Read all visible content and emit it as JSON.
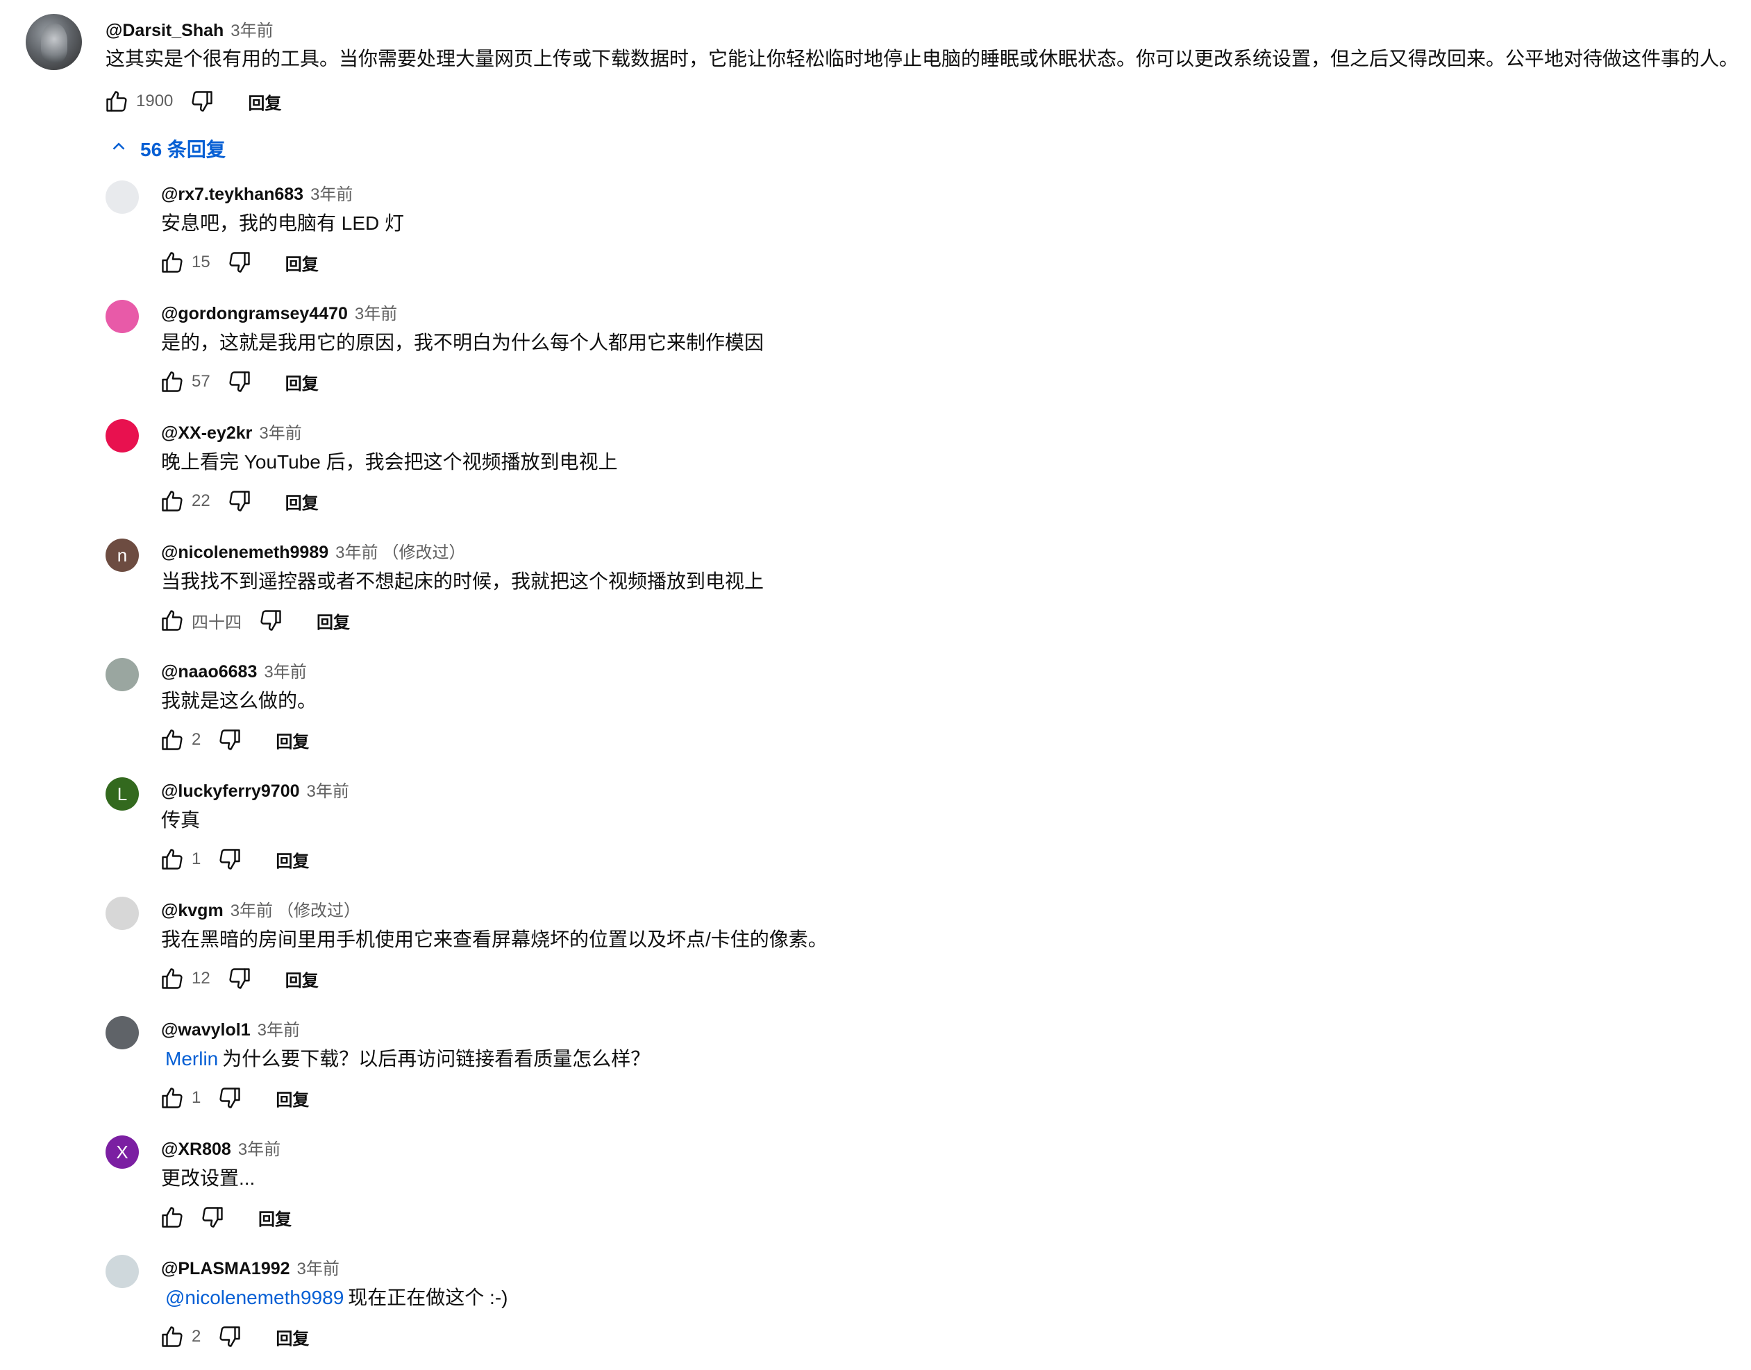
{
  "main_comment": {
    "author": "@Darsit_Shah",
    "time": "3年前",
    "text": "这其实是个很有用的工具。当你需要处理大量网页上传或下载数据时，它能让你轻松临时地停止电脑的睡眠或休眠状态。你可以更改系统设置，但之后又得改回来。公平地对待做这件事的人。",
    "likes": "1900",
    "reply_label": "回复"
  },
  "replies_toggle": {
    "label": "56 条回复",
    "icon": "chevron-up-icon"
  },
  "replies": [
    {
      "author": "@rx7.teykhan683",
      "time": "3年前",
      "edited": "",
      "mention": "",
      "text": "安息吧，我的电脑有 LED 灯",
      "likes": "15",
      "reply_label": "回复",
      "avatar_letter": "",
      "avatar_color": "#e8eaed"
    },
    {
      "author": "@gordongramsey4470",
      "time": "3年前",
      "edited": "",
      "mention": "",
      "text": "是的，这就是我用它的原因，我不明白为什么每个人都用它来制作模因",
      "likes": "57",
      "reply_label": "回复",
      "avatar_letter": "",
      "avatar_color": "#e85aa8"
    },
    {
      "author": "@XX-ey2kr",
      "time": "3年前",
      "edited": "",
      "mention": "",
      "text": "晚上看完 YouTube 后，我会把这个视频播放到电视上",
      "likes": "22",
      "reply_label": "回复",
      "avatar_letter": "",
      "avatar_color": "#e8114f"
    },
    {
      "author": "@nicolenemeth9989",
      "time": "3年前",
      "edited": "（修改过）",
      "mention": "",
      "text": "当我找不到遥控器或者不想起床的时候，我就把这个视频播放到电视上",
      "likes": "四十四",
      "reply_label": "回复",
      "avatar_letter": "n",
      "avatar_color": "#6d4c41"
    },
    {
      "author": "@naao6683",
      "time": "3年前",
      "edited": "",
      "mention": "",
      "text": "我就是这么做的。",
      "likes": "2",
      "reply_label": "回复",
      "avatar_letter": "",
      "avatar_color": "#9aa6a0"
    },
    {
      "author": "@luckyferry9700",
      "time": "3年前",
      "edited": "",
      "mention": "",
      "text": "传真",
      "likes": "1",
      "reply_label": "回复",
      "avatar_letter": "L",
      "avatar_color": "#33691e"
    },
    {
      "author": "@kvgm",
      "time": "3年前",
      "edited": "（修改过）",
      "mention": "",
      "text": "我在黑暗的房间里用手机使用它来查看屏幕烧坏的位置以及坏点/卡住的像素。",
      "likes": "12",
      "reply_label": "回复",
      "avatar_letter": "",
      "avatar_color": "#d7d7d7"
    },
    {
      "author": "@wavylol1",
      "time": "3年前",
      "edited": "",
      "mention": "Merlin",
      "text": "为什么要下载？以后再访问链接看看质量怎么样？",
      "likes": "1",
      "reply_label": "回复",
      "avatar_letter": "",
      "avatar_color": "#5f6368"
    },
    {
      "author": "@XR808",
      "time": "3年前",
      "edited": "",
      "mention": "",
      "text": "更改设置...",
      "likes": "",
      "reply_label": "回复",
      "avatar_letter": "X",
      "avatar_color": "#7b1fa2"
    },
    {
      "author": "@PLASMA1992",
      "time": "3年前",
      "edited": "",
      "mention": "@nicolenemeth9989",
      "text": "现在正在做这个 :-)",
      "likes": "2",
      "reply_label": "回复",
      "avatar_letter": "",
      "avatar_color": "#cfd8dc"
    }
  ],
  "icons": {
    "like": "thumbs-up-icon",
    "dislike": "thumbs-down-icon"
  }
}
